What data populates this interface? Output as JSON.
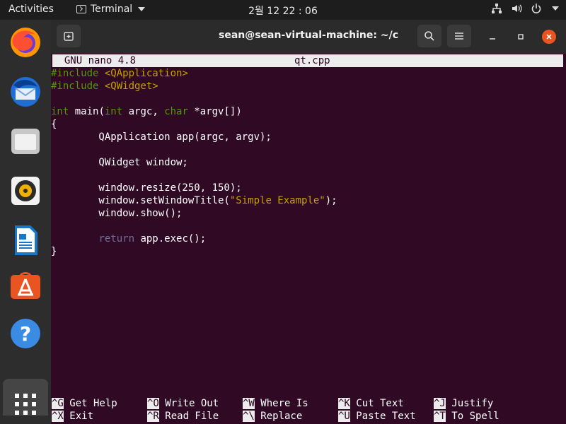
{
  "topbar": {
    "activities": "Activities",
    "app_name": "Terminal",
    "clock": "2월 12  22 : 06"
  },
  "dock": {
    "items": [
      "firefox-icon",
      "thunderbird-icon",
      "files-icon",
      "rhythmbox-icon",
      "libreoffice-writer-icon",
      "software-center-icon",
      "help-icon",
      "show-apps-icon"
    ]
  },
  "window": {
    "title": "sean@sean-virtual-machine: ~/c"
  },
  "nano": {
    "header_left": "  GNU nano 4.8",
    "header_file": "qt.cpp",
    "lines": [
      {
        "segments": [
          {
            "cls": "c-dir",
            "t": "#include "
          },
          {
            "cls": "c-str",
            "t": "<QApplication>"
          }
        ]
      },
      {
        "segments": [
          {
            "cls": "c-dir",
            "t": "#include "
          },
          {
            "cls": "c-str",
            "t": "<QWidget>"
          }
        ]
      },
      {
        "segments": []
      },
      {
        "segments": [
          {
            "cls": "c-type",
            "t": "int"
          },
          {
            "cls": "",
            "t": " main("
          },
          {
            "cls": "c-type",
            "t": "int"
          },
          {
            "cls": "",
            "t": " argc, "
          },
          {
            "cls": "c-type",
            "t": "char"
          },
          {
            "cls": "",
            "t": " *argv[])"
          }
        ]
      },
      {
        "segments": [
          {
            "cls": "",
            "t": "{"
          }
        ]
      },
      {
        "segments": [
          {
            "cls": "",
            "t": "        QApplication app(argc, argv);"
          }
        ]
      },
      {
        "segments": []
      },
      {
        "segments": [
          {
            "cls": "",
            "t": "        QWidget window;"
          }
        ]
      },
      {
        "segments": []
      },
      {
        "segments": [
          {
            "cls": "",
            "t": "        window.resize(250, 150);"
          }
        ]
      },
      {
        "segments": [
          {
            "cls": "",
            "t": "        window.setWindowTitle("
          },
          {
            "cls": "c-quote",
            "t": "\"Simple Example\""
          },
          {
            "cls": "",
            "t": ");"
          }
        ]
      },
      {
        "segments": [
          {
            "cls": "",
            "t": "        window.show();"
          }
        ]
      },
      {
        "segments": []
      },
      {
        "segments": [
          {
            "cls": "",
            "t": "        "
          },
          {
            "cls": "c-ret",
            "t": "return"
          },
          {
            "cls": "",
            "t": " app.exec();"
          }
        ]
      },
      {
        "segments": [
          {
            "cls": "",
            "t": "}"
          }
        ]
      }
    ],
    "shortcuts_row1": [
      {
        "key": "^G",
        "label": " Get Help"
      },
      {
        "key": "^O",
        "label": " Write Out"
      },
      {
        "key": "^W",
        "label": " Where Is"
      },
      {
        "key": "^K",
        "label": " Cut Text"
      },
      {
        "key": "^J",
        "label": " Justify"
      }
    ],
    "shortcuts_row2": [
      {
        "key": "^X",
        "label": " Exit"
      },
      {
        "key": "^R",
        "label": " Read File"
      },
      {
        "key": "^\\",
        "label": " Replace"
      },
      {
        "key": "^U",
        "label": " Paste Text"
      },
      {
        "key": "^T",
        "label": " To Spell"
      }
    ]
  }
}
